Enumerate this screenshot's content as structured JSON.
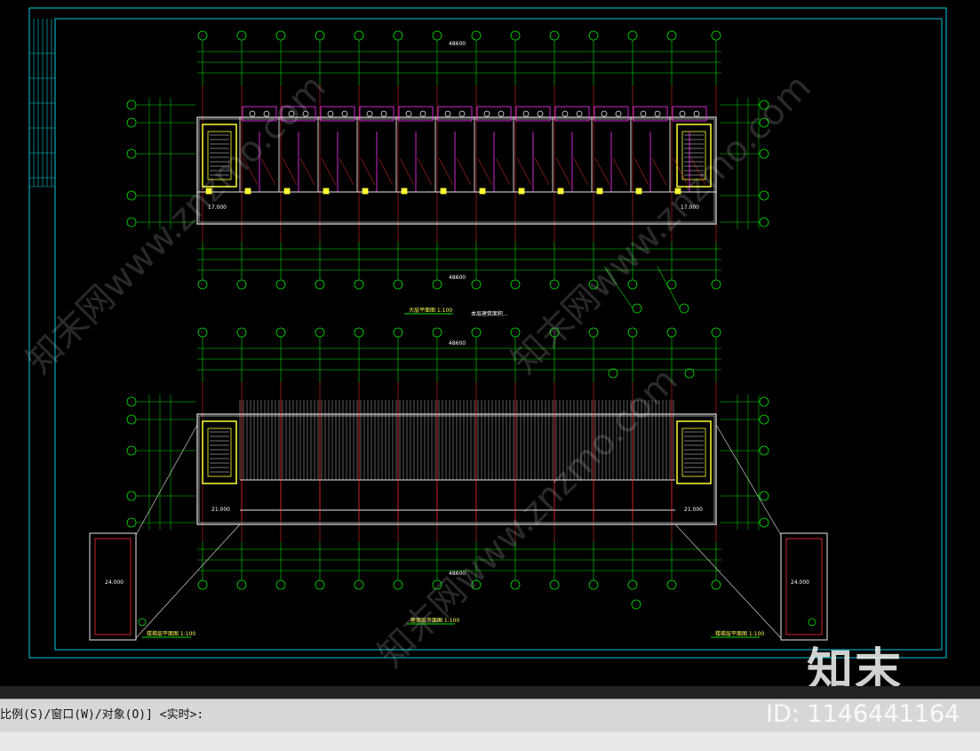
{
  "drawing": {
    "plan_titles": {
      "upper": "大层平面图 1:100",
      "upper_note": "本层建筑面积...",
      "lower": "屋面层平面图 1:100",
      "left_small": "楼梯层平面图 1:100",
      "right_small": "楼梯层平面图 1:100"
    },
    "total_dimension": "48600",
    "small_room_elev": "24.000",
    "elevation_marks": [
      "17.000",
      "17.000",
      "21.000",
      "21.000"
    ],
    "colors": {
      "grid_axis": "#00e000",
      "wall": "#e8e8e8",
      "stair": "#ffff33",
      "column": "#ff3030",
      "furniture": "#ff33ff",
      "frame": "#00c8dc",
      "text": "#ffff55"
    }
  },
  "command_line": {
    "text": "比例(S)/窗口(W)/对象(O)] <实时>:"
  },
  "watermark": {
    "brand": "知末",
    "id_text": "ID: 1146441164",
    "diag_text": "知末网www.znzmo.com"
  }
}
